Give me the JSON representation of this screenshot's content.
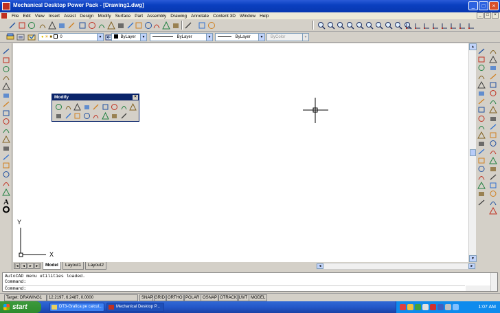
{
  "window": {
    "title": "Mechanical Desktop Power Pack - [Drawing1.dwg]"
  },
  "window_buttons": [
    "_",
    "□",
    "×"
  ],
  "doc_buttons": [
    "_",
    "□",
    "×"
  ],
  "menu": [
    "File",
    "Edit",
    "View",
    "Insert",
    "Assist",
    "Design",
    "Modify",
    "Surface",
    "Part",
    "Assembly",
    "Drawing",
    "Annotate",
    "Content 3D",
    "Window",
    "Help"
  ],
  "props_toolbar": {
    "layer": "0",
    "color": "ByLayer",
    "linetype": "ByLayer",
    "lineweight": "ByLayer",
    "plotstyle": "ByColor"
  },
  "modify_panel": {
    "title": "Modify",
    "close": "×"
  },
  "ucs": {
    "x": "X",
    "y": "Y"
  },
  "tabs": {
    "nav": [
      "|◄",
      "◄",
      "►",
      "►|"
    ],
    "items": [
      "Model",
      "Layout1",
      "Layout2"
    ],
    "active": "Model"
  },
  "command": {
    "lines": [
      "AutoCAD menu utilities loaded.",
      "Command:",
      "Command:"
    ]
  },
  "status": {
    "target": "Target: DRAWING1",
    "coords": "12.2197, 6.2487, 0.0000",
    "toggles": [
      "SNAP",
      "GRID",
      "ORTHO",
      "POLAR",
      "OSNAP",
      "OTRACK",
      "LWT",
      "MODEL"
    ]
  },
  "taskbar": {
    "start": "start",
    "tasks": [
      "DT3-Grafica pe calcul...",
      "Mechanical Desktop P..."
    ],
    "clock": "1:07 AM"
  },
  "icons": {
    "standard_toolbar": [
      "new-icon",
      "open-icon",
      "save-icon",
      "print-icon",
      "preview-icon",
      "publish-icon",
      "spellcheck-icon",
      "cut-icon",
      "copy-icon",
      "paste-icon",
      "match-properties-icon",
      "undo-icon",
      "redo-icon",
      "design-center-icon",
      "today-icon",
      "view-icon",
      "zoom-window-icon",
      "pan-icon",
      "zoom-realtime-icon",
      "properties-icon",
      "help-icon"
    ],
    "view_toolbar": [
      "zoom-in-icon",
      "zoom-out-icon",
      "zoom-all-icon",
      "zoom-extents-icon",
      "zoom-previous-icon",
      "zoom-scale-icon",
      "zoom-center-icon",
      "zoom-dynamic-icon",
      "zoom-object-icon",
      "grid-icon"
    ],
    "draw_toolbar": [
      "line-icon",
      "construction-line-icon",
      "polyline-icon",
      "polygon-icon",
      "rectangle-icon",
      "arc-icon",
      "circle-icon",
      "revision-cloud-icon",
      "spline-icon",
      "ellipse-icon",
      "ellipse-arc-icon",
      "insert-block-icon",
      "make-block-icon",
      "point-icon",
      "hatch-icon",
      "region-icon",
      "table-icon",
      "multiline-text-icon",
      "donut-icon"
    ]
  }
}
